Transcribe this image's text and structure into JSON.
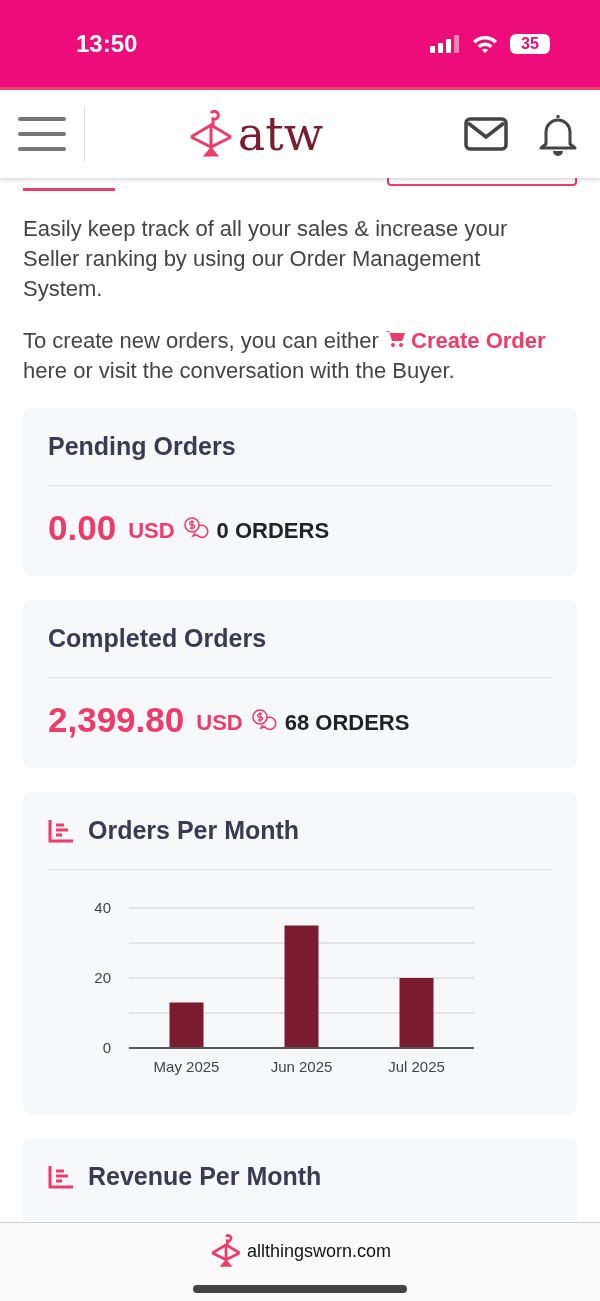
{
  "status_bar": {
    "time": "13:50",
    "battery": "35"
  },
  "header": {
    "logo_text": "atw"
  },
  "intro": {
    "paragraph": "Easily keep track of all your sales & increase your Seller ranking by using our Order Management System.",
    "create_before": "To create new orders, you can either",
    "create_link": "Create Order",
    "create_after": "here or visit the conversation with the Buyer."
  },
  "summaries": [
    {
      "title": "Pending Orders",
      "amount": "0.00",
      "currency": "USD",
      "orders": "0 ORDERS"
    },
    {
      "title": "Completed Orders",
      "amount": "2,399.80",
      "currency": "USD",
      "orders": "68 ORDERS"
    }
  ],
  "orders_chart": {
    "title": "Orders Per Month",
    "chart_data": {
      "type": "bar",
      "categories": [
        "May 2025",
        "Jun 2025",
        "Jul 2025"
      ],
      "series": [
        {
          "color": "#7b1c2e",
          "values": [
            13,
            35,
            20
          ]
        }
      ],
      "ylim": [
        0,
        40
      ],
      "yticks": [
        0,
        20,
        40
      ]
    }
  },
  "revenue_chart": {
    "title": "Revenue Per Month"
  },
  "browser_bar": {
    "url": "allthingsworn.com"
  }
}
